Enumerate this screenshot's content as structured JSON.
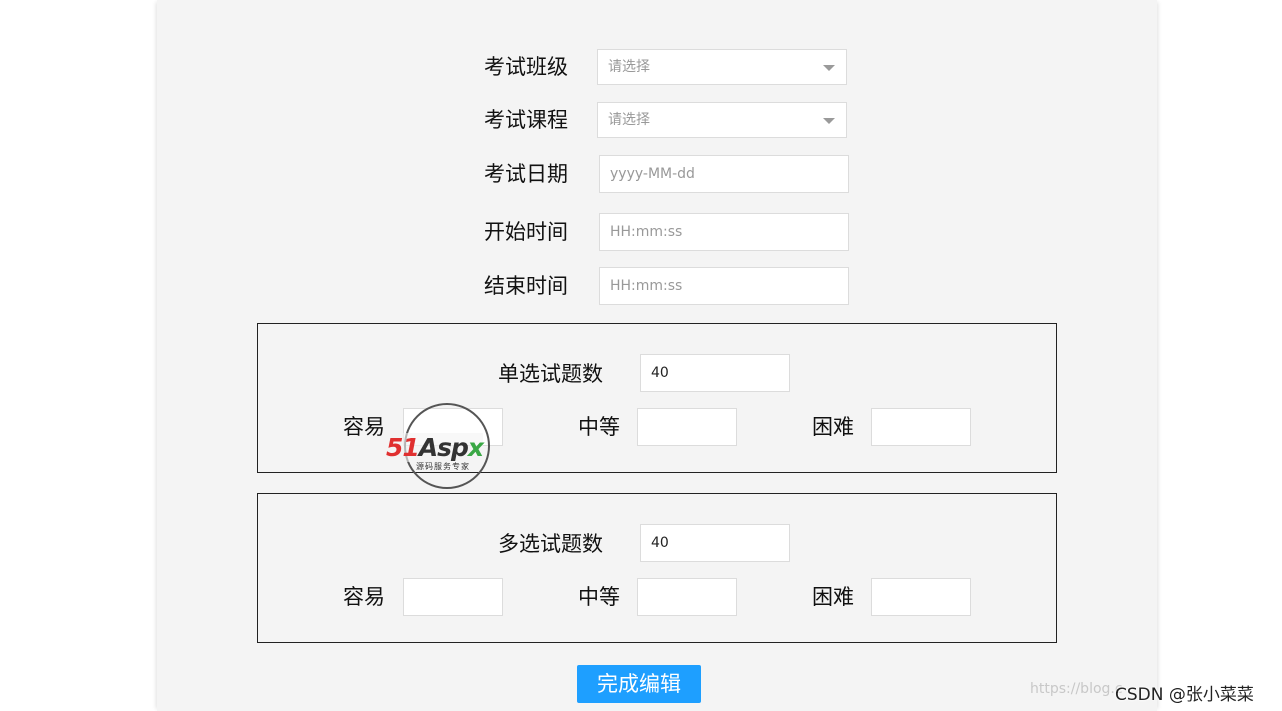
{
  "form": {
    "class_label": "考试班级",
    "class_placeholder": "请选择",
    "course_label": "考试课程",
    "course_placeholder": "请选择",
    "date_label": "考试日期",
    "date_placeholder": "yyyy-MM-dd",
    "start_label": "开始时间",
    "start_placeholder": "HH:mm:ss",
    "end_label": "结束时间",
    "end_placeholder": "HH:mm:ss"
  },
  "single_choice": {
    "count_label": "单选试题数",
    "count_value": "40",
    "easy_label": "容易",
    "easy_value": "",
    "medium_label": "中等",
    "medium_value": "",
    "hard_label": "困难",
    "hard_value": ""
  },
  "multi_choice": {
    "count_label": "多选试题数",
    "count_value": "40",
    "easy_label": "容易",
    "easy_value": "",
    "medium_label": "中等",
    "medium_value": "",
    "hard_label": "困难",
    "hard_value": ""
  },
  "submit_label": "完成编辑",
  "watermark": {
    "brand_51": "51",
    "brand_asp": "Asp",
    "brand_x": "x",
    "subtitle": "源码服务专家"
  },
  "credit": {
    "url": "https://blog.c",
    "author": "CSDN @张小菜菜"
  },
  "colors": {
    "panel_bg": "#f4f4f4",
    "button_bg": "#1e9fff"
  }
}
